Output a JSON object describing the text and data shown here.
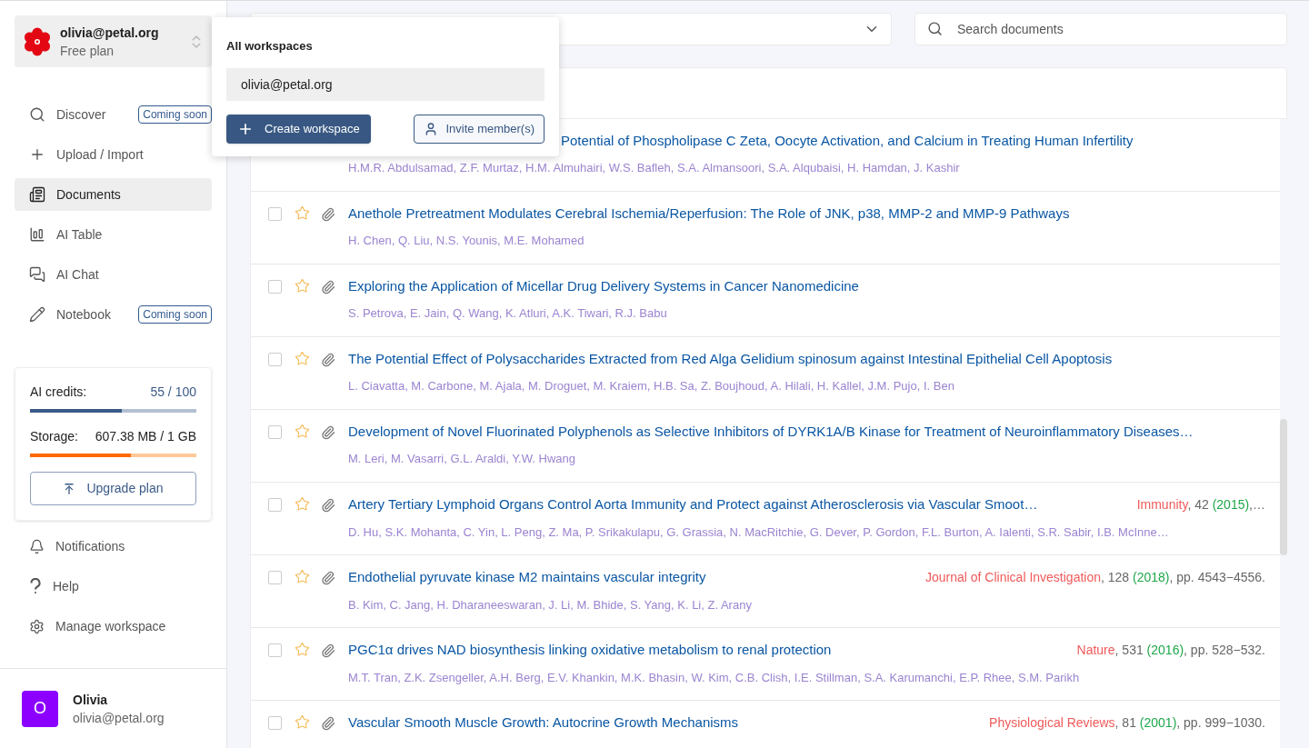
{
  "workspace": {
    "name": "olivia@petal.org",
    "plan": "Free plan"
  },
  "nav": [
    {
      "label": "Discover",
      "badge": "Coming soon",
      "selected": false
    },
    {
      "label": "Upload / Import",
      "selected": false
    },
    {
      "label": "Documents",
      "selected": true
    },
    {
      "label": "AI Table",
      "selected": false
    },
    {
      "label": "AI Chat",
      "selected": false
    },
    {
      "label": "Notebook",
      "badge": "Coming soon",
      "selected": false
    }
  ],
  "usage": [
    {
      "label": "AI credits:",
      "reading": "55 / 100",
      "level": 0.55,
      "kind": "credits"
    },
    {
      "label": "Storage:",
      "reading": "607.38 MB / 1 GB",
      "level": 0.607,
      "kind": "storage"
    }
  ],
  "upgrade_button": "Upgrade plan",
  "bottom_nav": [
    "Notifications",
    "Help",
    "Manage workspace"
  ],
  "user": {
    "initial": "O",
    "name": "Olivia",
    "email": "olivia@petal.org"
  },
  "workspace_menu": {
    "title": "All workspaces",
    "items": [
      {
        "label": "olivia@petal.org",
        "selected": true
      }
    ],
    "create_button": "Create workspace",
    "invite_button": "Invite member(s)"
  },
  "search": {
    "placeholder": "Search documents"
  },
  "documents": [
    {
      "kind": "partial",
      "title": "Potential of Phospholipase C Zeta, Oocyte Activation, and Calcium in Treating Human Infertility",
      "authors": "H.M.R. Abdulsamad, Z.F. Murtaz, H.M. Almuhairi, W.S. Bafleh, S.A. Almansoori, S.A. Alqubaisi, H. Hamdan, J. Kashir"
    },
    {
      "kind": "full",
      "checked": false,
      "starred": false,
      "title": "Anethole Pretreatment Modulates Cerebral Ischemia/Reperfusion: The Role of JNK, p38, MMP-2 and MMP-9 Pathways",
      "authors": "H. Chen, Q. Liu, N.S. Younis, M.E. Mohamed"
    },
    {
      "kind": "full",
      "checked": false,
      "starred": false,
      "title": "Exploring the Application of Micellar Drug Delivery Systems in Cancer Nanomedicine",
      "authors": "S. Petrova, E. Jain, Q. Wang, K. Atluri, A.K. Tiwari, R.J. Babu"
    },
    {
      "kind": "full",
      "checked": false,
      "starred": false,
      "title": "The Potential Effect of Polysaccharides Extracted from Red Alga Gelidium spinosum against Intestinal Epithelial Cell Apoptosis",
      "authors": "L. Ciavatta, M. Carbone, M. Ajala, M. Droguet, M. Kraiem, H.B. Sa, Z. Boujhoud, A. Hilali, H. Kallel, J.M. Pujo, I. Ben"
    },
    {
      "kind": "full",
      "checked": false,
      "starred": false,
      "title": "Development of Novel Fluorinated Polyphenols as Selective Inhibitors of DYRK1A/B Kinase for Treatment of Neuroinflammatory Diseases…",
      "authors": "M. Leri, M. Vasarri, G.L. Araldi, Y.W. Hwang"
    },
    {
      "kind": "full",
      "checked": false,
      "starred": false,
      "title": "Artery Tertiary Lymphoid Organs Control Aorta Immunity and Protect against Atherosclerosis via Vascular Smoot…",
      "authors": "D. Hu, S.K. Mohanta, C. Yin, L. Peng, Z. Ma, P. Srikakulapu, G. Grassia, N. MacRitchie, G. Dever, P. Gordon, F.L. Burton, A. Ialenti, S.R. Sabir, I.B. McInne…",
      "citation": {
        "journal": "Immunity",
        "volume": ", 42 ",
        "year": "(2015)",
        "pages": ",…"
      }
    },
    {
      "kind": "full",
      "checked": false,
      "starred": false,
      "title": "Endothelial pyruvate kinase M2 maintains vascular integrity",
      "authors": "B. Kim, C. Jang, H. Dharaneeswaran, J. Li, M. Bhide, S. Yang, K. Li, Z. Arany",
      "citation": {
        "journal": "Journal of Clinical Investigation",
        "volume": ", 128 ",
        "year": "(2018)",
        "pages": ", pp. 4543−4556."
      }
    },
    {
      "kind": "full",
      "checked": false,
      "starred": false,
      "title": "PGC1α drives NAD biosynthesis linking oxidative metabolism to renal protection",
      "authors": "M.T. Tran, Z.K. Zsengeller, A.H. Berg, E.V. Khankin, M.K. Bhasin, W. Kim, C.B. Clish, I.E. Stillman, S.A. Karumanchi, E.P. Rhee, S.M. Parikh",
      "citation": {
        "journal": "Nature",
        "volume": ", 531 ",
        "year": "(2016)",
        "pages": ", pp. 528−532."
      }
    },
    {
      "kind": "full",
      "checked": false,
      "starred": false,
      "title": "Vascular Smooth Muscle Growth: Autocrine Growth Mechanisms",
      "citation": {
        "journal": "Physiological Reviews",
        "volume": ", 81 ",
        "year": "(2001)",
        "pages": ", pp. 999−1030."
      }
    }
  ]
}
